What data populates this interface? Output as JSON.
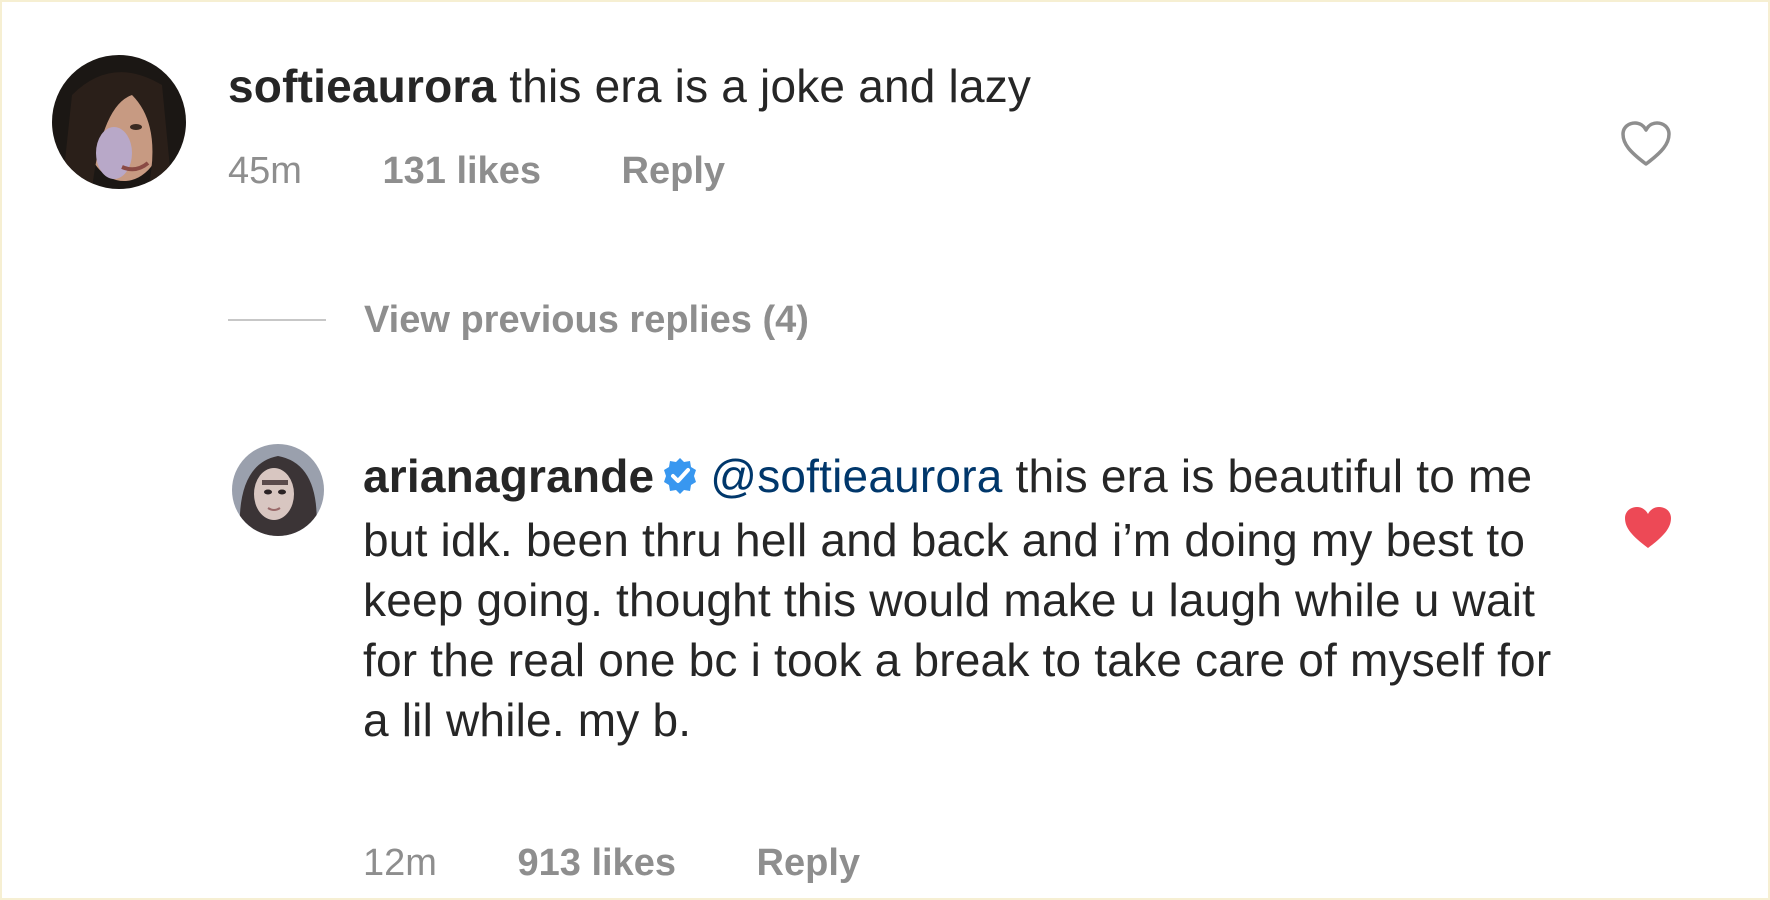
{
  "comments": [
    {
      "username": "softieaurora",
      "text": "this era is a joke and lazy",
      "time": "45m",
      "likes": "131 likes",
      "reply_label": "Reply",
      "liked": false
    },
    {
      "username": "arianagrande",
      "verified": true,
      "mention": "@softieaurora",
      "text": "this era is beautiful to me but idk. been thru hell and back and i’m doing my best to keep going. thought this would make u laugh while u wait for the real one bc i took a break to take care of myself for a lil while. my b.",
      "time": "12m",
      "likes": "913 likes",
      "reply_label": "Reply",
      "liked": true
    }
  ],
  "view_replies_label": "View previous replies (4)",
  "colors": {
    "liked_heart": "#ed4956",
    "muted_text": "#8e8e8e",
    "mention": "#00376b",
    "verified_badge": "#3897f0"
  }
}
